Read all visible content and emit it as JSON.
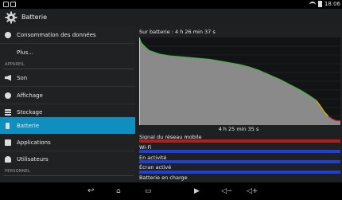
{
  "status_bar": {
    "time": "18:06"
  },
  "action_bar": {
    "title": "Batterie"
  },
  "sidebar": {
    "items": [
      {
        "label": "Consommation des données",
        "icon": "data-usage-icon"
      },
      {
        "label": "Plus...",
        "icon": ""
      },
      {
        "label": "Son",
        "icon": "sound-icon"
      },
      {
        "label": "Affichage",
        "icon": "display-icon"
      },
      {
        "label": "Stockage",
        "icon": "storage-icon"
      },
      {
        "label": "Batterie",
        "icon": "battery-icon"
      },
      {
        "label": "Applications",
        "icon": "apps-icon"
      },
      {
        "label": "Utilisateurs",
        "icon": "users-icon"
      }
    ],
    "headers": {
      "device": "APPAREIL",
      "personal": "PERSONNEL"
    },
    "selected": "Batterie"
  },
  "battery": {
    "on_battery_label": "Sur batterie : 4 h 26 min 37 s",
    "duration_label": "4 h 25 min 35 s",
    "chart_data": {
      "type": "area",
      "x": [
        0,
        0.01,
        0.03,
        0.05,
        0.1,
        0.15,
        0.2,
        0.25,
        0.3,
        0.35,
        0.4,
        0.45,
        0.5,
        0.55,
        0.6,
        0.65,
        0.7,
        0.75,
        0.8,
        0.85,
        0.88,
        0.9,
        0.92,
        0.94,
        0.96,
        0.98,
        1.0
      ],
      "values": [
        100,
        94,
        89,
        85,
        81,
        79,
        78,
        77,
        76,
        75,
        73,
        71,
        69,
        66,
        62,
        57,
        52,
        46,
        40,
        33,
        28,
        22,
        15,
        10,
        7,
        5,
        5
      ],
      "ylim": [
        0,
        100
      ],
      "colors": {
        "high": "#4caf50",
        "mid": "#d4b400",
        "low": "#c62828"
      }
    },
    "signals": [
      {
        "label": "Signal du réseau mobile",
        "color": "#b71c1c"
      },
      {
        "label": "Wi-Fi",
        "color": "#1e40d8"
      },
      {
        "label": "En activité",
        "color": "#1e40d8"
      },
      {
        "label": "Écran activé",
        "color": "#1e40d8"
      },
      {
        "label": "Batterie en charge",
        "color": ""
      }
    ]
  },
  "nav_icons": [
    "back-icon",
    "home-icon",
    "recent-apps-icon",
    "camera-icon",
    "volume-down-icon",
    "volume-up-icon"
  ]
}
